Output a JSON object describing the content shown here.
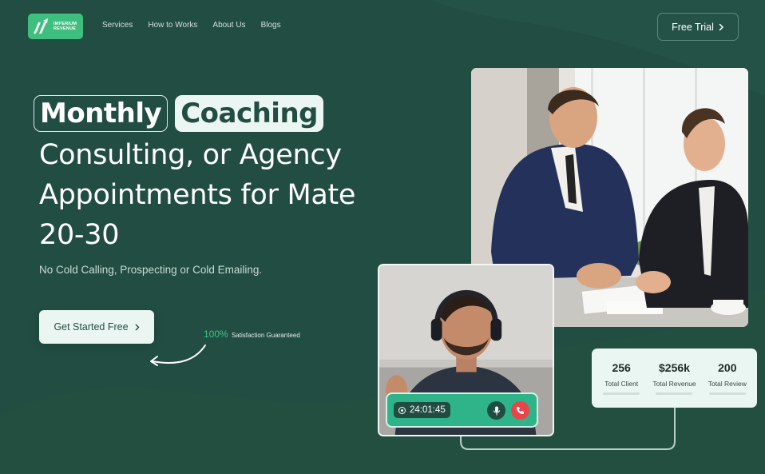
{
  "logo": {
    "line1": "IMPERIUM",
    "line2": "REVENUE"
  },
  "nav": {
    "items": [
      {
        "label": "Services"
      },
      {
        "label": "How to Works"
      },
      {
        "label": "About Us"
      },
      {
        "label": "Blogs"
      }
    ],
    "cta_label": "Free Trial",
    "cta_icon": "chevron-right-icon"
  },
  "hero": {
    "highlight_outline": "Monthly",
    "highlight_filled": "Coaching",
    "line2": "Consulting, or Agency",
    "line3": "Appointments for Mate",
    "line4": "20-30",
    "subtitle": "No Cold Calling, Prospecting or Cold Emailing.",
    "cta_label": "Get Started Free",
    "satisfaction_percent": "100%",
    "satisfaction_text": "Satisfaction Guaranteed"
  },
  "call": {
    "timer": "24:01:45",
    "mic_icon": "microphone-icon",
    "end_icon": "phone-end-icon"
  },
  "stats": [
    {
      "value": "256",
      "label": "Total Client"
    },
    {
      "value": "$256k",
      "label": "Total Revenue"
    },
    {
      "value": "200",
      "label": "Total Review"
    }
  ],
  "colors": {
    "background": "#224d42",
    "accent": "#3fbf7f",
    "call_bar": "#2fb389",
    "end_call": "#e8454a",
    "light_panel": "#e9f6f2"
  }
}
